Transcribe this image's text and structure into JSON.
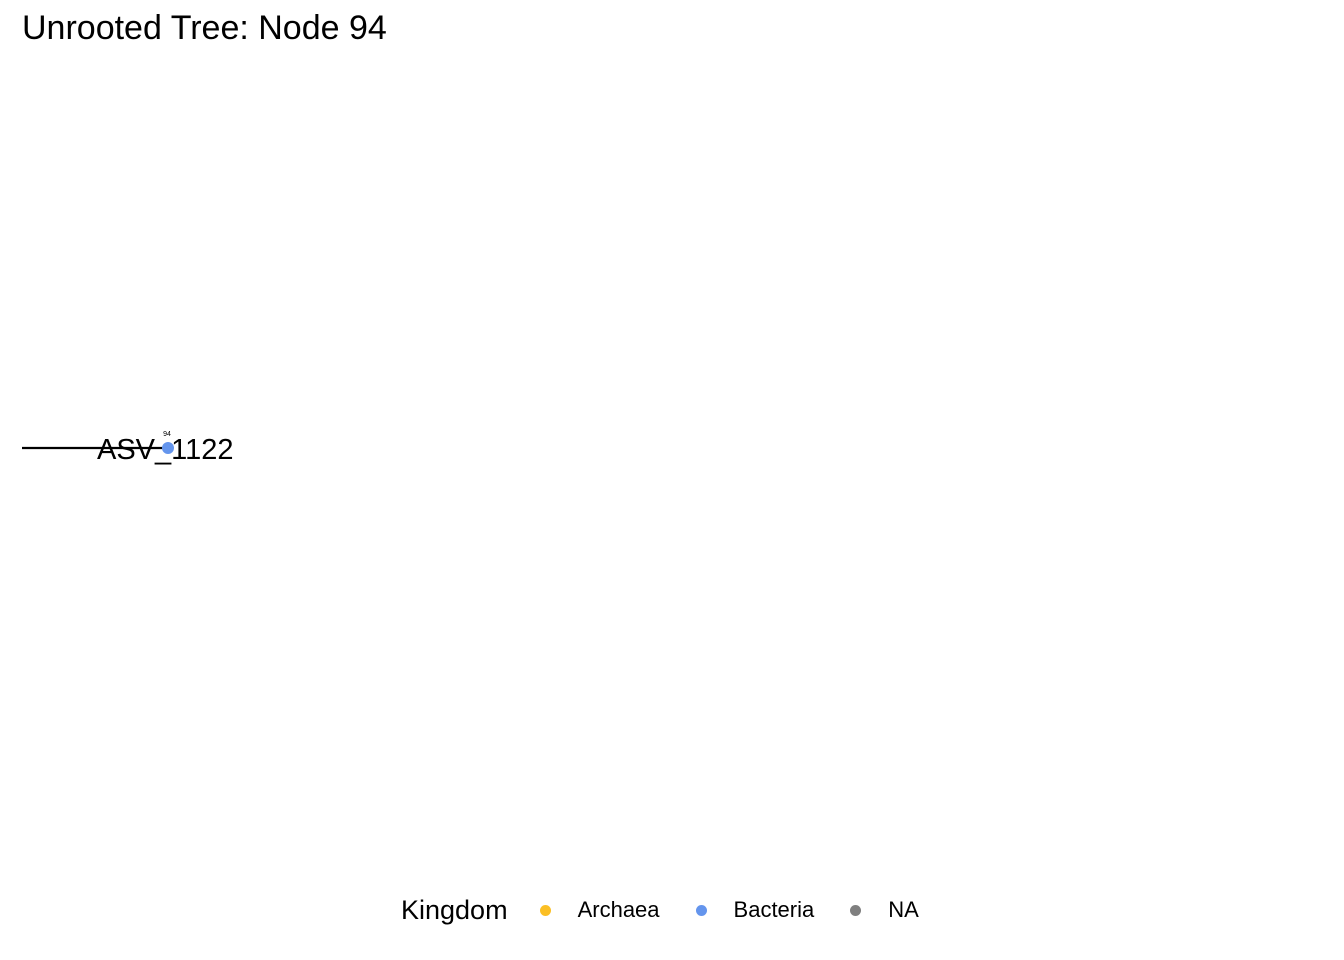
{
  "title": "Unrooted Tree: Node 94",
  "tree": {
    "tip_label": "ASV_1122",
    "node_label": "94",
    "tip_kingdom": "Bacteria"
  },
  "legend": {
    "title": "Kingdom",
    "items": [
      {
        "label": "Archaea",
        "color": "#FBBF24"
      },
      {
        "label": "Bacteria",
        "color": "#6495ED"
      },
      {
        "label": "NA",
        "color": "#7F7F7F"
      }
    ]
  }
}
